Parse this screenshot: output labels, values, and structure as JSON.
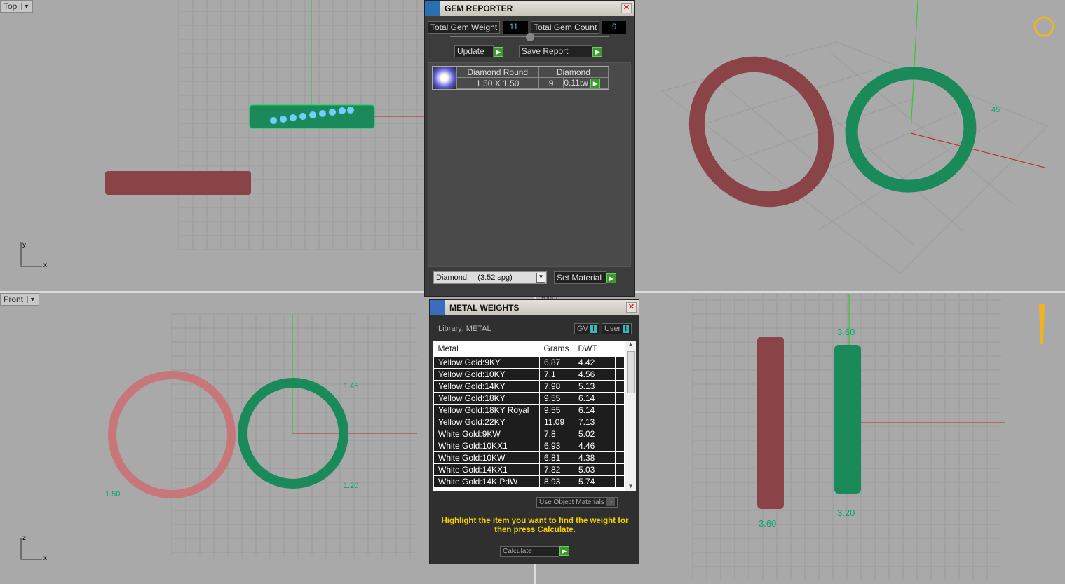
{
  "viewports": {
    "top": "Top",
    "front": "Front",
    "right_partial": "Right"
  },
  "axes": {
    "y": "y",
    "x": "x",
    "z": "z"
  },
  "dimensions": {
    "d145_persp": "45",
    "d145_front": "1.45",
    "d150": "1.50",
    "d120": "1.20",
    "d360_top": "3.60",
    "d360_bottom": "3.60",
    "d320": "3.20"
  },
  "gem_reporter": {
    "title": "GEM REPORTER",
    "total_weight_label": "Total Gem Weight",
    "total_weight": ".11",
    "total_count_label": "Total Gem Count",
    "total_count": "9",
    "update": "Update",
    "save_report": "Save Report",
    "gem": {
      "shape": "Diamond Round",
      "material": "Diamond",
      "size": "1.50 X 1.50",
      "count": "9",
      "weight": "0.11tw"
    },
    "material_select": "Diamond     (3.52 spg)",
    "set_material": "Set Material"
  },
  "metal_weights": {
    "title": "METAL WEIGHTS",
    "library": "Library: METAL",
    "gv": "GV",
    "user": "User",
    "columns": [
      "Metal",
      "Grams",
      "DWT"
    ],
    "rows": [
      [
        "Yellow Gold:9KY",
        "6.87",
        "4.42"
      ],
      [
        "Yellow Gold:10KY",
        "7.1",
        "4.56"
      ],
      [
        "Yellow Gold:14KY",
        "7.98",
        "5.13"
      ],
      [
        "Yellow Gold:18KY",
        "9.55",
        "6.14"
      ],
      [
        "Yellow Gold:18KY Royal",
        "9.55",
        "6.14"
      ],
      [
        "Yellow Gold:22KY",
        "11.09",
        "7.13"
      ],
      [
        "White Gold:9KW",
        "7.8",
        "5.02"
      ],
      [
        "White Gold:10KX1",
        "6.93",
        "4.46"
      ],
      [
        "White Gold:10KW",
        "6.81",
        "4.38"
      ],
      [
        "White Gold:14KX1",
        "7.82",
        "5.03"
      ],
      [
        "White Gold:14K PdW",
        "8.93",
        "5.74"
      ]
    ],
    "use_object_materials": "Use Object Materials",
    "hint": "Highlight the item you want to find the weight for then press Calculate.",
    "calculate": "Calculate"
  }
}
